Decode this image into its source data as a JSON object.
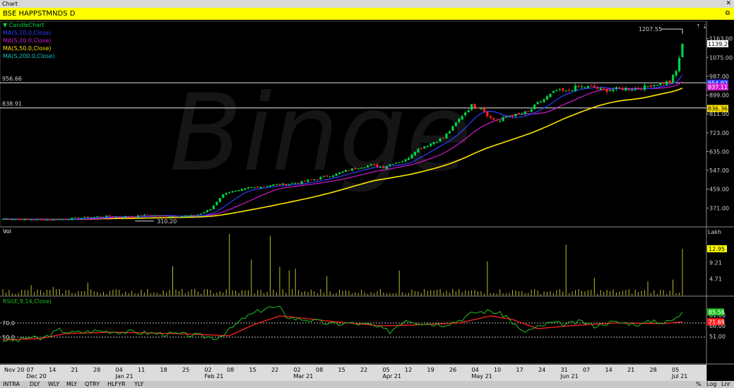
{
  "window": {
    "title": "Chart",
    "close_glyph": "✕"
  },
  "header": {
    "title": "BSE HAPPSTMNDS D",
    "restore_glyph": "⧉"
  },
  "colors": {
    "up": "#00d24a",
    "down": "#ff2020",
    "ma10": "#2d3cff",
    "ma20": "#d11ad1",
    "ma50": "#ffe600",
    "ma200": "#19c0c0",
    "vol": "#bdbd2a",
    "rsi": "#20c020",
    "rsi_ma": "#ff2020"
  },
  "legend": [
    {
      "text": "CandleChart",
      "color": "#00d24a"
    },
    {
      "text": "MA(S,10.0,Close)",
      "color": "#2d3cff"
    },
    {
      "text": "MA(S,20.0,Close)",
      "color": "#d11ad1"
    },
    {
      "text": "MA(S,50.0,Close)",
      "color": "#ffe600"
    },
    {
      "text": "MA(S,200.0,Close)",
      "color": "#19c0c0"
    }
  ],
  "vol_label": "Vol",
  "rsi_label": "RSI(E,9,14,Close)",
  "lakh_label": "Lakh",
  "watermark": "Binge",
  "bottom_tabs": [
    "INTRA",
    "DLY",
    "WLY",
    "MLY",
    "QTRY",
    "HLFYR",
    "YLY"
  ],
  "bottom_right": [
    "%",
    "Log",
    "Lnr"
  ],
  "chart_data": [
    {
      "type": "candlestick",
      "title": "BSE HAPPSTMNDS D",
      "ylim": [
        283,
        1251
      ],
      "y_ticks": [
        "1163.00",
        "1075.00",
        "987.00",
        "899.00",
        "811.00",
        "723.00",
        "635.00",
        "547.00",
        "459.00",
        "371.00"
      ],
      "y_tick_values": [
        1163,
        1075,
        987,
        899,
        811,
        723,
        635,
        547,
        459,
        371
      ],
      "horizontal_lines": [
        {
          "label": "956.66",
          "value": 956.66
        },
        {
          "label": "838.91",
          "value": 838.91
        }
      ],
      "annotations": [
        {
          "text": "1207.55",
          "type": "high"
        },
        {
          "text": "310.20",
          "type": "low"
        }
      ],
      "price_tags": [
        {
          "text": "1139.20",
          "value": 1139.2,
          "bg": "#ffffff",
          "fg": "#000000"
        },
        {
          "text": "954.92",
          "value": 954.92,
          "bg": "#2d3cff",
          "fg": "#ffffff"
        },
        {
          "text": "937.11",
          "value": 937.11,
          "bg": "#d11ad1",
          "fg": "#ffffff"
        },
        {
          "text": "836.36",
          "value": 836.36,
          "bg": "#ffe600",
          "fg": "#000000"
        }
      ],
      "x_labels": [
        "Nov 20",
        "07",
        "14",
        "21",
        "28",
        "04",
        "11",
        "18",
        "25",
        "02",
        "08",
        "15",
        "22",
        "02",
        "08",
        "15",
        "22",
        "05",
        "12",
        "19",
        "26",
        "04",
        "10",
        "17",
        "24",
        "31",
        "07",
        "14",
        "21",
        "28",
        "05"
      ],
      "x_months": [
        "Dec 20",
        "Jan 21",
        "Feb 21",
        "Mar 21",
        "Apr 21",
        "May 21",
        "Jun 21",
        "Jul 21"
      ],
      "anchors": [
        [
          0,
          320
        ],
        [
          15,
          316
        ],
        [
          25,
          325
        ],
        [
          33,
          333
        ],
        [
          37,
          330
        ],
        [
          42,
          332
        ],
        [
          46,
          339
        ],
        [
          50,
          335
        ],
        [
          55,
          332
        ],
        [
          60,
          335
        ],
        [
          63,
          345
        ],
        [
          66,
          365
        ],
        [
          69,
          420
        ],
        [
          71,
          445
        ],
        [
          75,
          450
        ],
        [
          78,
          465
        ],
        [
          81,
          470
        ],
        [
          85,
          478
        ],
        [
          90,
          482
        ],
        [
          95,
          492
        ],
        [
          99,
          505
        ],
        [
          103,
          520
        ],
        [
          106,
          530
        ],
        [
          109,
          545
        ],
        [
          113,
          560
        ],
        [
          117,
          572
        ],
        [
          121,
          562
        ],
        [
          124,
          582
        ],
        [
          128,
          595
        ],
        [
          131,
          640
        ],
        [
          134,
          660
        ],
        [
          137,
          680
        ],
        [
          140,
          700
        ],
        [
          143,
          748
        ],
        [
          146,
          805
        ],
        [
          149,
          850
        ],
        [
          152,
          842
        ],
        [
          155,
          790
        ],
        [
          158,
          778
        ],
        [
          160,
          800
        ],
        [
          163,
          805
        ],
        [
          167,
          820
        ],
        [
          170,
          860
        ],
        [
          173,
          890
        ],
        [
          176,
          920
        ],
        [
          179,
          915
        ],
        [
          182,
          935
        ],
        [
          185,
          938
        ],
        [
          188,
          935
        ],
        [
          191,
          920
        ],
        [
          194,
          925
        ],
        [
          197,
          930
        ],
        [
          200,
          928
        ],
        [
          203,
          932
        ],
        [
          206,
          945
        ],
        [
          209,
          955
        ],
        [
          212,
          960
        ],
        [
          214,
          1010
        ],
        [
          216,
          1139.2
        ]
      ],
      "bars": 217,
      "series": [
        {
          "name": "MA(S,10.0,Close)",
          "last": 954.92
        },
        {
          "name": "MA(S,20.0,Close)",
          "last": 937.11
        },
        {
          "name": "MA(S,50.0,Close)",
          "last": 836.36
        }
      ]
    },
    {
      "type": "bar",
      "title": "Vol",
      "unit": "Lakh",
      "y_ticks": [
        "12.95",
        "9.21",
        "4.71"
      ],
      "y_tick_values": [
        12.95,
        9.21,
        4.71
      ],
      "ylim": [
        0,
        17
      ],
      "last": 12.95,
      "spikes": [
        [
          9,
          3.0
        ],
        [
          16,
          2.5
        ],
        [
          27,
          3.7
        ],
        [
          54,
          8.2
        ],
        [
          72,
          17
        ],
        [
          79,
          10
        ],
        [
          85,
          16.5
        ],
        [
          88,
          8.0
        ],
        [
          91,
          7.0
        ],
        [
          93,
          7.5
        ],
        [
          103,
          5.5
        ],
        [
          126,
          7.0
        ],
        [
          154,
          9.5
        ],
        [
          179,
          14.0
        ],
        [
          188,
          5.0
        ],
        [
          205,
          4.0
        ],
        [
          213,
          4.5
        ],
        [
          216,
          12.95
        ]
      ]
    },
    {
      "type": "line",
      "title": "RSI(E,9,14,Close)",
      "ylim": [
        40,
        100
      ],
      "y_ticks": [
        "81.00",
        "66.00",
        "51.00"
      ],
      "y_tick_values": [
        81,
        66,
        51
      ],
      "left_labels": [
        "70.0",
        "50.0"
      ],
      "horizontal_lines": [
        70,
        50
      ],
      "tags": [
        {
          "text": "85.56",
          "value": 85.56,
          "bg": "#20c020"
        },
        {
          "text": "71.69",
          "value": 71.69,
          "bg": "#ff2020"
        }
      ],
      "anchors": [
        [
          0,
          46
        ],
        [
          5,
          45
        ],
        [
          8,
          50
        ],
        [
          12,
          47
        ],
        [
          18,
          60
        ],
        [
          22,
          56
        ],
        [
          30,
          59
        ],
        [
          40,
          57
        ],
        [
          50,
          55
        ],
        [
          60,
          53
        ],
        [
          68,
          49
        ],
        [
          72,
          60
        ],
        [
          77,
          78
        ],
        [
          80,
          84
        ],
        [
          84,
          92
        ],
        [
          88,
          91
        ],
        [
          90,
          80
        ],
        [
          93,
          76
        ],
        [
          97,
          75
        ],
        [
          100,
          72
        ],
        [
          105,
          68
        ],
        [
          110,
          70
        ],
        [
          117,
          67
        ],
        [
          123,
          58
        ],
        [
          128,
          75
        ],
        [
          133,
          70
        ],
        [
          140,
          68
        ],
        [
          144,
          72
        ],
        [
          150,
          85
        ],
        [
          155,
          87
        ],
        [
          160,
          80
        ],
        [
          165,
          57
        ],
        [
          169,
          62
        ],
        [
          174,
          70
        ],
        [
          179,
          68
        ],
        [
          184,
          72
        ],
        [
          188,
          66
        ],
        [
          193,
          71
        ],
        [
          198,
          70
        ],
        [
          203,
          68
        ],
        [
          207,
          74
        ],
        [
          210,
          70
        ],
        [
          214,
          76
        ],
        [
          216,
          85.56
        ]
      ],
      "ma_anchors": [
        [
          0,
          46
        ],
        [
          12,
          48
        ],
        [
          20,
          55
        ],
        [
          35,
          57
        ],
        [
          55,
          55
        ],
        [
          72,
          52
        ],
        [
          80,
          68
        ],
        [
          88,
          80
        ],
        [
          95,
          77
        ],
        [
          105,
          72
        ],
        [
          120,
          66
        ],
        [
          130,
          67
        ],
        [
          145,
          70
        ],
        [
          155,
          80
        ],
        [
          162,
          75
        ],
        [
          170,
          62
        ],
        [
          180,
          66
        ],
        [
          195,
          70
        ],
        [
          210,
          69
        ],
        [
          216,
          71.69
        ]
      ]
    }
  ]
}
